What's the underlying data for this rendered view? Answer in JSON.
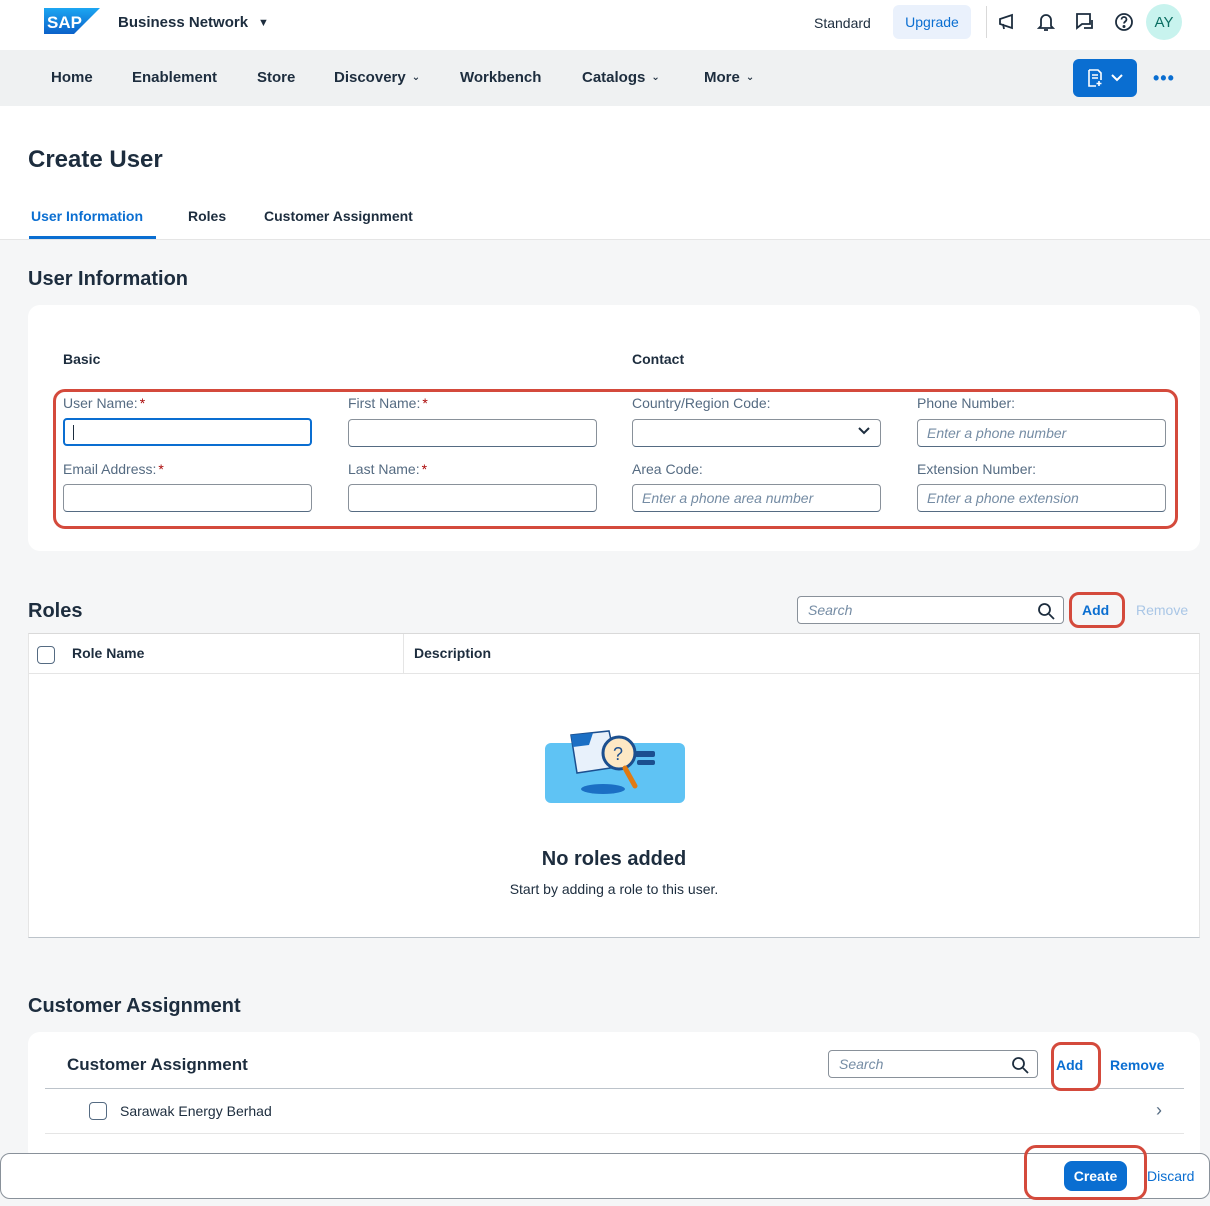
{
  "shell": {
    "logo_text": "SAP",
    "product": "Business Network",
    "product_caret": "▼",
    "standard": "Standard",
    "upgrade": "Upgrade",
    "avatar": "AY",
    "icons": [
      "megaphone-icon",
      "bell-icon",
      "chat-icon",
      "help-icon"
    ]
  },
  "nav": {
    "items": [
      "Home",
      "Enablement",
      "Store",
      "Discovery",
      "Workbench",
      "Catalogs",
      "More"
    ],
    "more_dots": "•••"
  },
  "page": {
    "title": "Create User",
    "tabs": [
      "User Information",
      "Roles",
      "Customer Assignment"
    ]
  },
  "user_info": {
    "section_title": "User Information",
    "basic_title": "Basic",
    "contact_title": "Contact",
    "required_mark": "*",
    "fields": {
      "user_name": {
        "label": "User Name:",
        "value": ""
      },
      "first_name": {
        "label": "First Name:",
        "value": ""
      },
      "email": {
        "label": "Email Address:",
        "value": ""
      },
      "last_name": {
        "label": "Last Name:",
        "value": ""
      },
      "country_code": {
        "label": "Country/Region Code:",
        "value": ""
      },
      "phone": {
        "label": "Phone Number:",
        "placeholder": "Enter a phone number"
      },
      "area_code": {
        "label": "Area Code:",
        "placeholder": "Enter a phone area number"
      },
      "extension": {
        "label": "Extension Number:",
        "placeholder": "Enter a phone extension"
      }
    }
  },
  "roles": {
    "section_title": "Roles",
    "search_placeholder": "Search",
    "add": "Add",
    "remove": "Remove",
    "columns": [
      "Role Name",
      "Description"
    ],
    "empty_title": "No roles added",
    "empty_subtitle": "Start by adding a role to this user."
  },
  "customer_assignment": {
    "section_title": "Customer Assignment",
    "card_title": "Customer Assignment",
    "search_placeholder": "Search",
    "add": "Add",
    "remove": "Remove",
    "rows": [
      {
        "name": "Sarawak Energy Berhad"
      }
    ],
    "row_chevron": "›"
  },
  "footer": {
    "create": "Create",
    "discard": "Discard"
  },
  "colors": {
    "accent": "#0a6ed1",
    "highlight": "#d44a3c",
    "required": "#aa0808"
  }
}
